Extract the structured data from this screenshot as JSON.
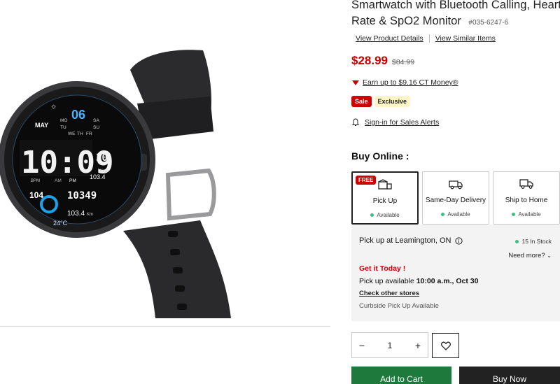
{
  "product": {
    "title": "Smartwatch with Bluetooth Calling, Heart Rate & SpO2 Monitor",
    "sku": "#035-6247-6"
  },
  "links": {
    "details": "View Product Details",
    "similar": "View Similar Items"
  },
  "price": {
    "current": "$28.99",
    "original": "$84.99"
  },
  "ct_money": "Earn up to $9.16 CT Money®",
  "badges": {
    "sale": "Sale",
    "exclusive": "Exclusive"
  },
  "alerts": "Sign-in for Sales Alerts",
  "buy_online": {
    "heading": "Buy Online :",
    "free_badge": "FREE",
    "options": [
      {
        "label": "Pick Up",
        "availability": "Available",
        "icon": "store-icon"
      },
      {
        "label": "Same-Day Delivery",
        "availability": "Available",
        "icon": "delivery-van-icon"
      },
      {
        "label": "Ship to Home",
        "availability": "Available",
        "icon": "shipping-truck-icon"
      }
    ]
  },
  "pickup": {
    "location": "Pick up at Leamington, ON",
    "stock": "15 In Stock",
    "need_more": "Need more?",
    "get_it_today": "Get it Today !",
    "available_prefix": "Pick up available",
    "available_time": "10:00 a.m., Oct 30",
    "check_other": "Check other stores",
    "curbside": "Curbside Pick Up Available"
  },
  "quantity": {
    "minus": "−",
    "value": "1",
    "plus": "+"
  },
  "actions": {
    "add_to_cart": "Add to Cart",
    "buy_now": "Buy Now"
  },
  "watch_face": {
    "day_number": "06",
    "month": "MAY",
    "weekdays": [
      "MO",
      "TU",
      "WE",
      "TH",
      "FR",
      "SA",
      "SU"
    ],
    "time": "10:09",
    "seconds": "30",
    "kcal_label": "Kcal",
    "kcal": "103.4",
    "bpm_label": "BPM",
    "bpm": "104",
    "am": "AM",
    "pm": "PM",
    "steps": "10349",
    "distance": "103.4",
    "distance_unit": "Km",
    "temperature": "24°C"
  },
  "colors": {
    "price_red": "#cc0000",
    "cart_green": "#1e7a3c",
    "available_dot": "#3bbf85",
    "exclusive_bg": "#fff4c7"
  }
}
